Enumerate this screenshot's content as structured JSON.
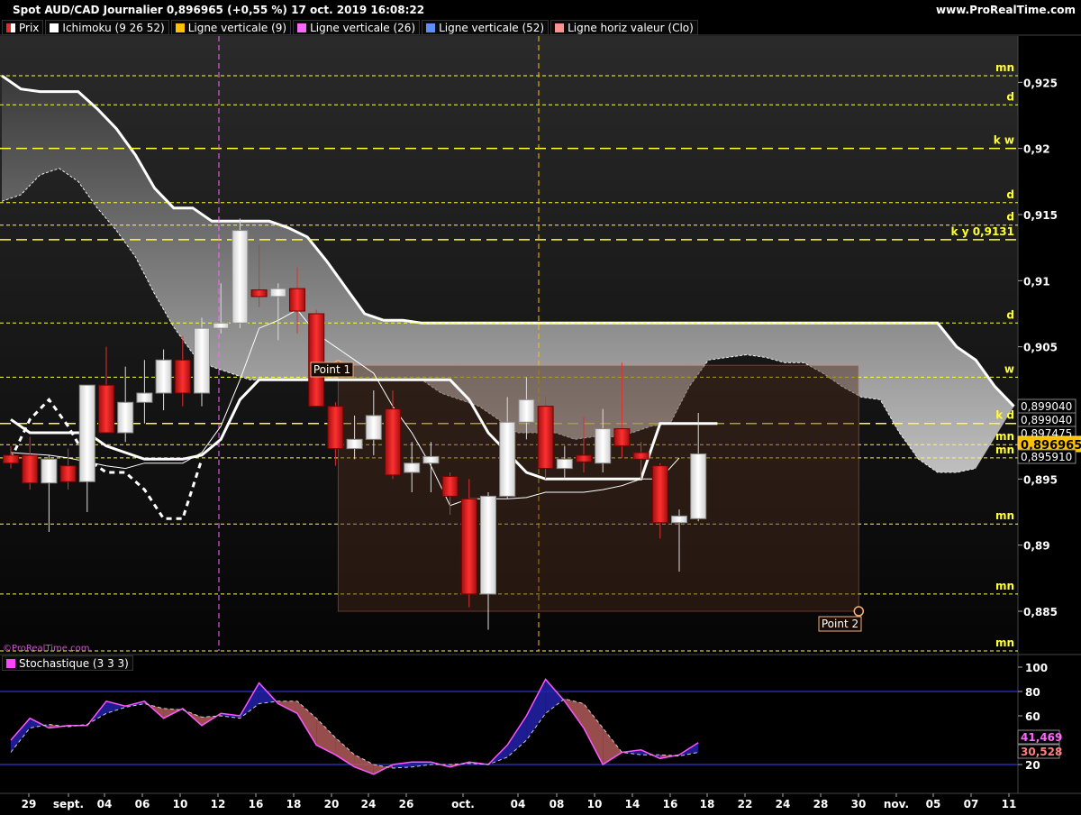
{
  "header": {
    "title": "Spot AUD/CAD Journalier 0,896965 (+0,55 %) 17 oct. 2019 16:08:22",
    "site": "www.ProRealTime.com",
    "watermark": "©ProRealTime.com"
  },
  "legend": [
    {
      "label": "Prix",
      "color": "#ffffff"
    },
    {
      "label": "Ichimoku (9 26 52)",
      "color": "#ffffff"
    },
    {
      "label": "Ligne verticale (9)",
      "color": "#ffd700"
    },
    {
      "label": "Ligne verticale (26)",
      "color": "#ff66ff"
    },
    {
      "label": "Ligne verticale (52)",
      "color": "#5577ff"
    },
    {
      "label": "Ligne horiz valeur (Clo)",
      "color": "#ff8080"
    }
  ],
  "stoch_legend": {
    "label": "Stochastique (3 3 3)",
    "color": "#ff44ff"
  },
  "colors": {
    "up": "#ffffff",
    "down": "#e8282a",
    "cloud": "#a0a0a0",
    "level": "#ffff33",
    "box": "#e0785a",
    "stoch_k": "#ff55ff",
    "stoch_band": "#3344ff"
  },
  "chart_data": [
    {
      "type": "candlestick",
      "title": "Spot AUD/CAD Journalier",
      "ylim": [
        0.882,
        0.9285
      ],
      "y_ticks": [
        0.925,
        0.92,
        0.915,
        0.91,
        0.905,
        0.9,
        0.895,
        0.89,
        0.885
      ],
      "y_tick_labels": [
        "0,925",
        "0,92",
        "0,915",
        "0,91",
        "0,905",
        "0,9",
        "0,895",
        "0,89",
        "0,885"
      ],
      "x_labels": [
        "29",
        "sept.",
        "04",
        "06",
        "10",
        "12",
        "16",
        "18",
        "20",
        "24",
        "26",
        "oct.",
        "04",
        "08",
        "10",
        "14",
        "16",
        "18",
        "22",
        "24",
        "28",
        "30",
        "nov.",
        "05",
        "07",
        "11"
      ],
      "candles": [
        {
          "o": 0.8968,
          "h": 0.8975,
          "l": 0.8958,
          "c": 0.8962
        },
        {
          "o": 0.8968,
          "h": 0.8982,
          "l": 0.8942,
          "c": 0.8947
        },
        {
          "o": 0.8947,
          "h": 0.8968,
          "l": 0.891,
          "c": 0.8965
        },
        {
          "o": 0.896,
          "h": 0.8973,
          "l": 0.8942,
          "c": 0.8948
        },
        {
          "o": 0.8948,
          "h": 0.9015,
          "l": 0.8925,
          "c": 0.9021
        },
        {
          "o": 0.9021,
          "h": 0.905,
          "l": 0.8992,
          "c": 0.8985
        },
        {
          "o": 0.8985,
          "h": 0.9035,
          "l": 0.8978,
          "c": 0.9008
        },
        {
          "o": 0.9008,
          "h": 0.904,
          "l": 0.8992,
          "c": 0.9015
        },
        {
          "o": 0.9015,
          "h": 0.9048,
          "l": 0.9002,
          "c": 0.904
        },
        {
          "o": 0.904,
          "h": 0.9058,
          "l": 0.9005,
          "c": 0.9015
        },
        {
          "o": 0.9015,
          "h": 0.9072,
          "l": 0.9005,
          "c": 0.9064
        },
        {
          "o": 0.9064,
          "h": 0.9098,
          "l": 0.906,
          "c": 0.9068
        },
        {
          "o": 0.9068,
          "h": 0.9147,
          "l": 0.9064,
          "c": 0.9138
        },
        {
          "o": 0.9093,
          "h": 0.9127,
          "l": 0.908,
          "c": 0.9088
        },
        {
          "o": 0.9088,
          "h": 0.9098,
          "l": 0.9055,
          "c": 0.9094
        },
        {
          "o": 0.9094,
          "h": 0.911,
          "l": 0.906,
          "c": 0.9077
        },
        {
          "o": 0.9075,
          "h": 0.9078,
          "l": 0.9005,
          "c": 0.9005
        },
        {
          "o": 0.9005,
          "h": 0.9008,
          "l": 0.896,
          "c": 0.8973
        },
        {
          "o": 0.8973,
          "h": 0.8998,
          "l": 0.8965,
          "c": 0.898
        },
        {
          "o": 0.898,
          "h": 0.9017,
          "l": 0.8968,
          "c": 0.8998
        },
        {
          "o": 0.9003,
          "h": 0.9017,
          "l": 0.895,
          "c": 0.8953
        },
        {
          "o": 0.8955,
          "h": 0.8978,
          "l": 0.894,
          "c": 0.8962
        },
        {
          "o": 0.8962,
          "h": 0.8978,
          "l": 0.894,
          "c": 0.8967
        },
        {
          "o": 0.8952,
          "h": 0.8955,
          "l": 0.8923,
          "c": 0.8937
        },
        {
          "o": 0.8935,
          "h": 0.895,
          "l": 0.8853,
          "c": 0.8863
        },
        {
          "o": 0.8863,
          "h": 0.894,
          "l": 0.8836,
          "c": 0.8937
        },
        {
          "o": 0.8937,
          "h": 0.9012,
          "l": 0.8935,
          "c": 0.8993
        },
        {
          "o": 0.8993,
          "h": 0.9027,
          "l": 0.898,
          "c": 0.901
        },
        {
          "o": 0.9005,
          "h": 0.9013,
          "l": 0.895,
          "c": 0.8958
        },
        {
          "o": 0.8958,
          "h": 0.8975,
          "l": 0.895,
          "c": 0.8965
        },
        {
          "o": 0.8968,
          "h": 0.8997,
          "l": 0.8955,
          "c": 0.8963
        },
        {
          "o": 0.8962,
          "h": 0.9003,
          "l": 0.8955,
          "c": 0.8988
        },
        {
          "o": 0.8988,
          "h": 0.9038,
          "l": 0.8966,
          "c": 0.8975
        },
        {
          "o": 0.897,
          "h": 0.8978,
          "l": 0.895,
          "c": 0.8965
        },
        {
          "o": 0.896,
          "h": 0.8962,
          "l": 0.8905,
          "c": 0.8917
        },
        {
          "o": 0.8917,
          "h": 0.8927,
          "l": 0.888,
          "c": 0.8922
        },
        {
          "o": 0.892,
          "h": 0.9,
          "l": 0.8918,
          "c": 0.8969
        }
      ],
      "levels": [
        {
          "label": "mn",
          "value": 0.9255
        },
        {
          "label": "d",
          "value": 0.9233
        },
        {
          "label": "k w",
          "value": 0.92
        },
        {
          "label": "d",
          "value": 0.9159
        },
        {
          "label": "d",
          "value": 0.9142
        },
        {
          "label": "k y 0,9131",
          "value": 0.9131
        },
        {
          "label": "d",
          "value": 0.9068
        },
        {
          "label": "w",
          "value": 0.9027
        },
        {
          "label": "k d",
          "value": 0.8992
        },
        {
          "label": "mn",
          "value": 0.8976
        },
        {
          "label": "mn",
          "value": 0.8966
        },
        {
          "label": "mn",
          "value": 0.8916
        },
        {
          "label": "mn",
          "value": 0.8863
        },
        {
          "label": "mn",
          "value": 0.882
        }
      ],
      "price_labels": [
        "0,899040",
        "0,899040",
        "0,897475",
        "0,896965",
        "0,895910"
      ],
      "current_price": "0,896965",
      "points": [
        {
          "label": "Point 1",
          "index": 17.0,
          "value": 0.9036
        },
        {
          "label": "Point 2",
          "index": 44.4,
          "value": 0.885
        }
      ],
      "tenkan": [
        0.897,
        0.8969,
        0.8968,
        0.8966,
        0.8963,
        0.896,
        0.8958,
        0.8962,
        0.8962,
        0.8962,
        0.897,
        0.899,
        0.9025,
        0.9064,
        0.907,
        0.9078,
        0.906,
        0.905,
        0.904,
        0.903,
        0.9005,
        0.8985,
        0.896,
        0.893,
        0.8935,
        0.8935,
        0.8935,
        0.8936,
        0.894,
        0.894,
        0.894,
        0.8942,
        0.8945,
        0.895,
        0.895,
        0.8966
      ],
      "kijun": [
        0.8995,
        0.8985,
        0.8985,
        0.8985,
        0.8985,
        0.8975,
        0.897,
        0.8965,
        0.8965,
        0.8965,
        0.8968,
        0.898,
        0.901,
        0.9025,
        0.9025,
        0.9025,
        0.9025,
        0.9025,
        0.9025,
        0.9025,
        0.9025,
        0.9025,
        0.9025,
        0.9025,
        0.901,
        0.8985,
        0.897,
        0.8955,
        0.895,
        0.895,
        0.895,
        0.895,
        0.895,
        0.895,
        0.8992,
        0.8992,
        0.8992,
        0.8992
      ],
      "chikou": [
        0.8965,
        0.8995,
        0.901,
        0.899,
        0.8965,
        0.8955,
        0.8955,
        0.8942,
        0.892,
        0.892,
        0.8965
      ]
    },
    {
      "type": "line",
      "title": "Stochastique (3 3 3)",
      "ylim": [
        0,
        100
      ],
      "y_ticks": [
        100,
        80,
        60,
        40,
        20
      ],
      "y_tick_labels": [
        "100",
        "80",
        "60",
        "40",
        "20"
      ],
      "value_labels": [
        "41,469",
        "30,528"
      ],
      "k": [
        40,
        58,
        50,
        52,
        52,
        72,
        68,
        72,
        58,
        66,
        52,
        62,
        60,
        87,
        70,
        62,
        36,
        28,
        18,
        12,
        20,
        22,
        22,
        18,
        22,
        20,
        36,
        60,
        90,
        72,
        50,
        20,
        30,
        32,
        25,
        28,
        38
      ],
      "d": [
        30,
        50,
        53,
        51,
        53,
        62,
        67,
        70,
        66,
        65,
        59,
        60,
        58,
        70,
        72,
        72,
        58,
        42,
        28,
        20,
        17,
        18,
        20,
        20,
        21,
        20,
        26,
        40,
        62,
        74,
        70,
        50,
        30,
        28,
        28,
        27,
        30
      ],
      "bands": [
        80,
        20
      ]
    }
  ]
}
